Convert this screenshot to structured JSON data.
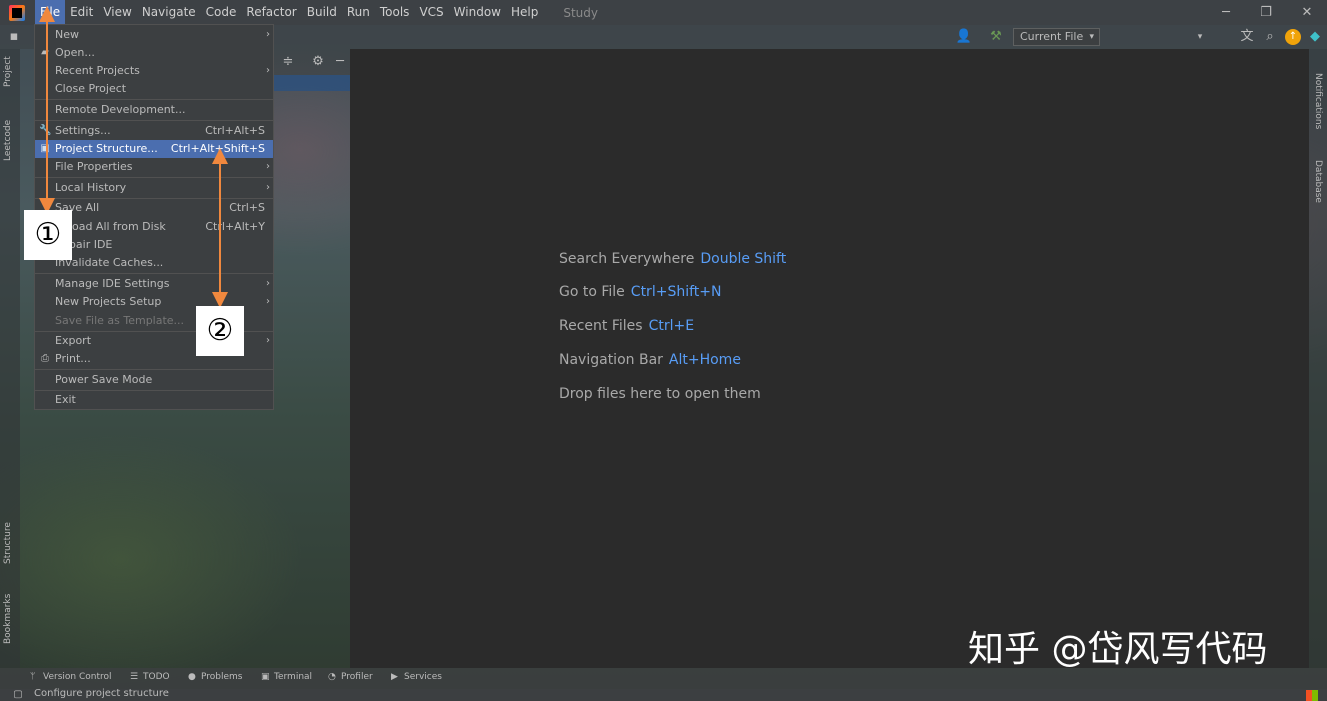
{
  "menubar": {
    "items": [
      "File",
      "Edit",
      "View",
      "Navigate",
      "Code",
      "Refactor",
      "Build",
      "Run",
      "Tools",
      "VCS",
      "Window",
      "Help"
    ],
    "active_index": 0,
    "project_title": "Study"
  },
  "toolbar": {
    "run_config": "Current File"
  },
  "left_tabs": [
    "Project",
    "Leetcode",
    "Structure",
    "Bookmarks"
  ],
  "right_tabs": [
    "Notifications",
    "Database"
  ],
  "file_menu": {
    "items": [
      {
        "label": "New",
        "shortcut": "",
        "submenu": true
      },
      {
        "label": "Open...",
        "shortcut": "",
        "submenu": false
      },
      {
        "label": "Recent Projects",
        "shortcut": "",
        "submenu": true
      },
      {
        "label": "Close Project",
        "shortcut": "",
        "submenu": false
      },
      {
        "label": "Remote Development...",
        "shortcut": "",
        "submenu": false
      },
      {
        "label": "Settings...",
        "shortcut": "Ctrl+Alt+S",
        "submenu": false
      },
      {
        "label": "Project Structure...",
        "shortcut": "Ctrl+Alt+Shift+S",
        "submenu": false,
        "selected": true
      },
      {
        "label": "File Properties",
        "shortcut": "",
        "submenu": true
      },
      {
        "label": "Local History",
        "shortcut": "",
        "submenu": true
      },
      {
        "label": "Save All",
        "shortcut": "Ctrl+S",
        "submenu": false
      },
      {
        "label": "Reload All from Disk",
        "shortcut": "Ctrl+Alt+Y",
        "submenu": false
      },
      {
        "label": "Repair IDE",
        "shortcut": "",
        "submenu": false
      },
      {
        "label": "Invalidate Caches...",
        "shortcut": "",
        "submenu": false
      },
      {
        "label": "Manage IDE Settings",
        "shortcut": "",
        "submenu": true
      },
      {
        "label": "New Projects Setup",
        "shortcut": "",
        "submenu": true
      },
      {
        "label": "Save File as Template...",
        "shortcut": "",
        "submenu": false,
        "disabled": true
      },
      {
        "label": "Export",
        "shortcut": "",
        "submenu": true
      },
      {
        "label": "Print...",
        "shortcut": "",
        "submenu": false
      },
      {
        "label": "Power Save Mode",
        "shortcut": "",
        "submenu": false
      },
      {
        "label": "Exit",
        "shortcut": "",
        "submenu": false
      }
    ]
  },
  "editor_hints": [
    {
      "text": "Search Everywhere",
      "key": "Double Shift"
    },
    {
      "text": "Go to File",
      "key": "Ctrl+Shift+N"
    },
    {
      "text": "Recent Files",
      "key": "Ctrl+E"
    },
    {
      "text": "Navigation Bar",
      "key": "Alt+Home"
    },
    {
      "text": "Drop files here to open them",
      "key": ""
    }
  ],
  "annotations": [
    "①",
    "②"
  ],
  "bottom_tools": [
    "Version Control",
    "TODO",
    "Problems",
    "Terminal",
    "Profiler",
    "Services"
  ],
  "status": {
    "text": "Configure project structure"
  },
  "watermark": "知乎 @岱风写代码",
  "colors": {
    "selection": "#4b6eaf",
    "shortcut_key": "#589df6",
    "annotation_arrow": "#f0883e",
    "editor_bg": "#2b2b2b"
  }
}
